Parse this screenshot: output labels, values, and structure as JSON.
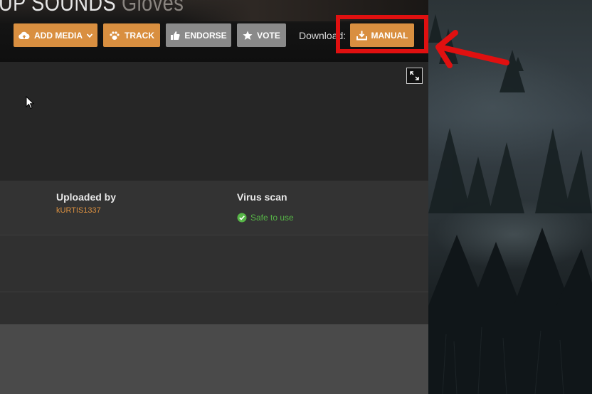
{
  "header": {
    "title_main": "UP SOUNDS",
    "title_dim": "Gloves"
  },
  "toolbar": {
    "add_media_label": "ADD MEDIA",
    "track_label": "TRACK",
    "endorse_label": "ENDORSE",
    "vote_label": "VOTE",
    "download_label": "Download:",
    "manual_label": "MANUAL"
  },
  "details": {
    "uploaded_by_label": "Uploaded by",
    "uploader_name": "kURTIS1337",
    "virus_scan_label": "Virus scan",
    "virus_scan_status": "Safe to use"
  },
  "colors": {
    "accent_orange": "#d98f40",
    "button_grey": "#8a8a8a",
    "safe_green": "#57b547",
    "highlight_red": "#e01010"
  },
  "icons": {
    "add_media": "cloud-upload-icon",
    "track": "paw-icon",
    "endorse": "thumbs-up-icon",
    "vote": "star-icon",
    "manual": "download-icon",
    "fullscreen": "expand-icon",
    "virus_ok": "check-circle-icon"
  }
}
